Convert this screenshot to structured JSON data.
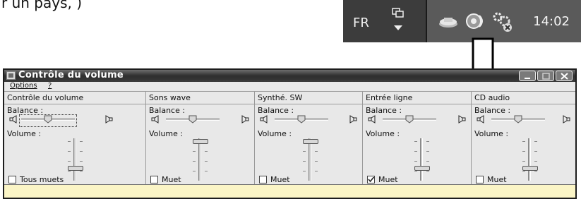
{
  "caption_fragment": "r un pays, )",
  "taskbar": {
    "language": "FR",
    "clock": "14:02",
    "icons": [
      "language-options-icon",
      "network-icon",
      "volume-tray-icon",
      "error-settings-icon"
    ]
  },
  "window": {
    "title": "Contrôle du volume",
    "controls": [
      "minimize-icon",
      "maximize-icon",
      "close-icon"
    ],
    "menu": [
      "Options",
      "?"
    ],
    "panels": [
      {
        "title": "Contrôle du volume",
        "balance_label": "Balance :",
        "volume_label": "Volume :",
        "mute_label": "Tous muets",
        "mute_checked": false,
        "balance": 0.5,
        "volume": 0.25
      },
      {
        "title": "Sons wave",
        "balance_label": "Balance :",
        "volume_label": "Volume :",
        "mute_label": "Muet",
        "mute_checked": false,
        "balance": 0.5,
        "volume": 1.0
      },
      {
        "title": "Synthé. SW",
        "balance_label": "Balance :",
        "volume_label": "Volume :",
        "mute_label": "Muet",
        "mute_checked": false,
        "balance": 0.5,
        "volume": 1.0
      },
      {
        "title": "Entrée ligne",
        "balance_label": "Balance :",
        "volume_label": "Volume :",
        "mute_label": "Muet",
        "mute_checked": true,
        "balance": 0.5,
        "volume": 0.25
      },
      {
        "title": "CD audio",
        "balance_label": "Balance :",
        "volume_label": "Volume :",
        "mute_label": "Muet",
        "mute_checked": false,
        "balance": 0.5,
        "volume": 0.25
      }
    ]
  },
  "colors": {
    "taskbar": "#2e2e2e",
    "status_bar": "#fbf5c6",
    "window_bg": "#e8e8e8"
  }
}
